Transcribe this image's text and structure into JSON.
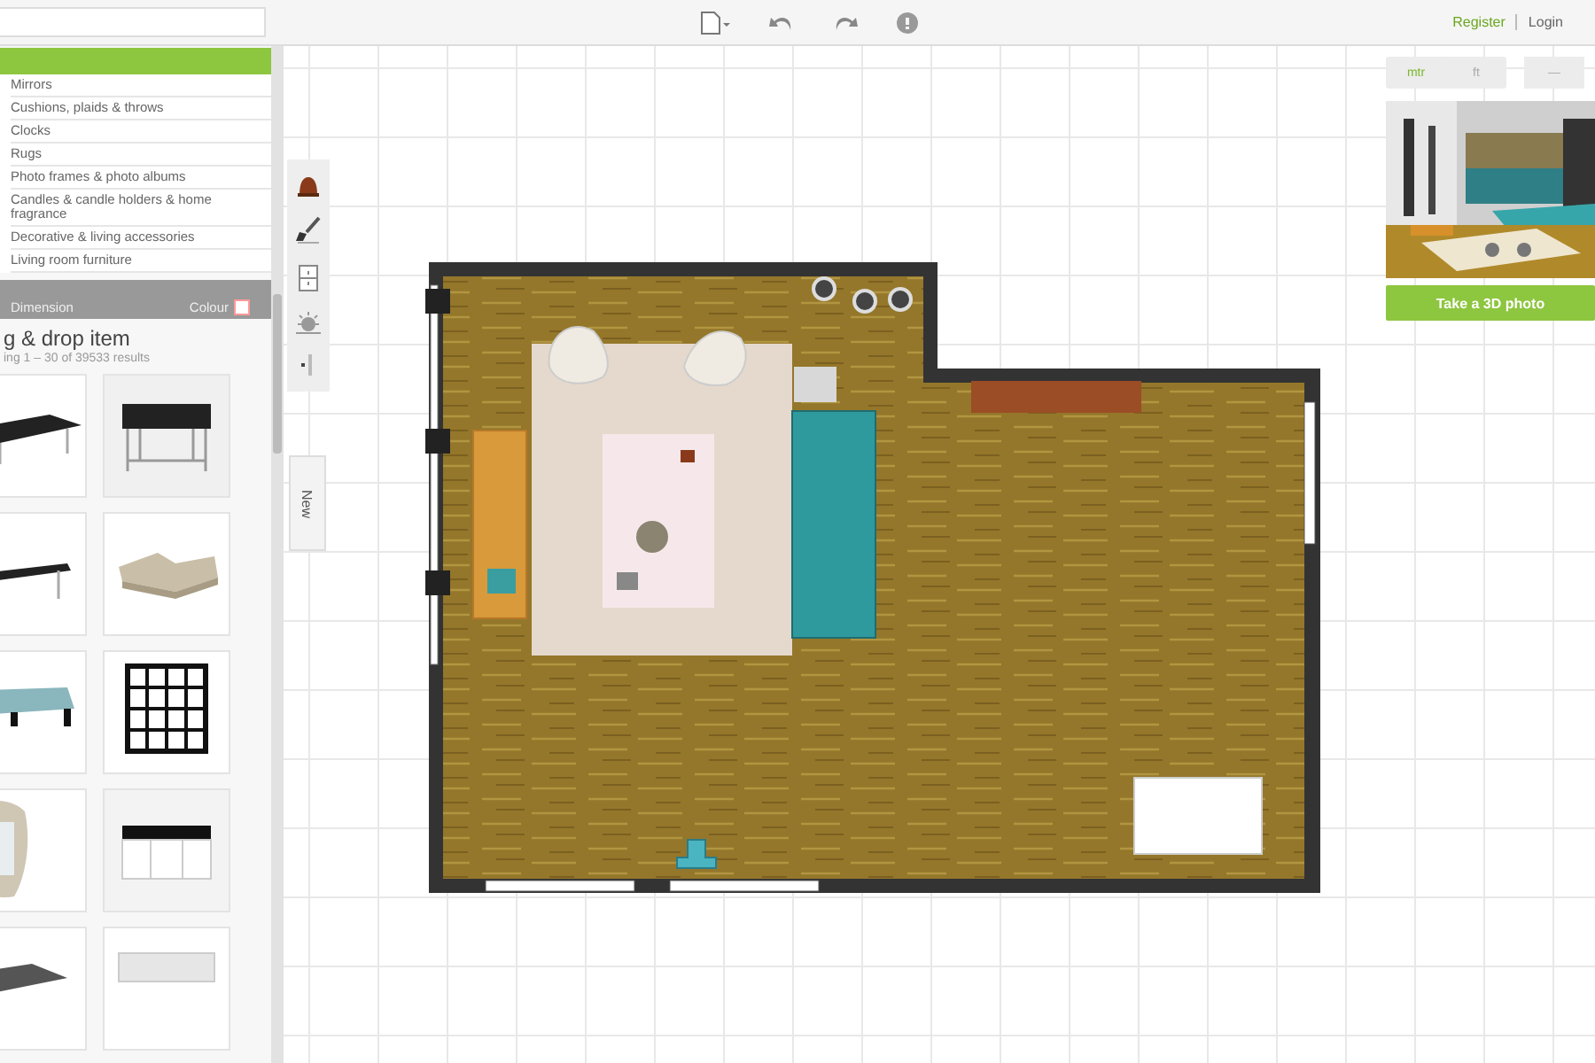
{
  "account_links": [
    {
      "label": "Register",
      "kind": "primary"
    },
    {
      "label": "Login",
      "kind": "plain"
    }
  ],
  "categories": [
    "Mirrors",
    "Cushions, plaids & throws",
    "Clocks",
    "Rugs",
    "Photo frames & photo albums",
    "Candles & candle holders & home fragrance",
    "Decorative & living accessories",
    "Living room furniture"
  ],
  "filters": [
    "Dimension",
    "Colour"
  ],
  "results": {
    "heading": "g & drop item",
    "count": "ing 1 – 30 of 39533 results"
  },
  "products": [
    {
      "kind": "picture"
    },
    {
      "kind": "picture"
    },
    {
      "kind": "picture"
    },
    {
      "kind": "picture"
    },
    {
      "kind": "picture"
    },
    {
      "kind": "picture"
    },
    {
      "kind": "picture"
    },
    {
      "kind": "picture"
    },
    {
      "kind": "picture"
    },
    {
      "kind": "picture"
    }
  ],
  "side_tab": {
    "label": "New"
  },
  "units": [
    {
      "label": "mtr",
      "selected": true
    },
    {
      "label": "ft",
      "selected": false
    }
  ],
  "zoom_buttons": [
    "—"
  ],
  "preview": {
    "kind": "picture",
    "button": "Take a 3D photo"
  }
}
